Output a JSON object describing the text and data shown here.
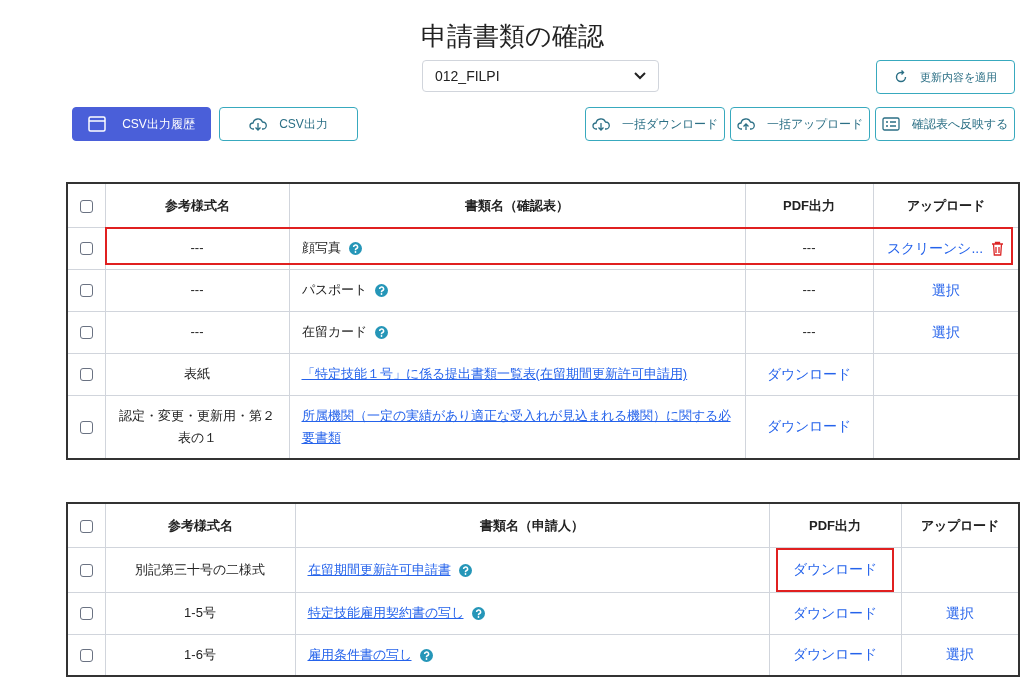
{
  "title": "申請書類の確認",
  "select": {
    "value": "012_FILPI"
  },
  "apply_button": {
    "label": "更新内容を適用"
  },
  "toolbar_left": [
    {
      "label": "CSV出力履歴",
      "kind": "history",
      "primary": true
    },
    {
      "label": "CSV出力",
      "kind": "download",
      "primary": false
    }
  ],
  "toolbar_right": [
    {
      "label": "一括ダウンロード",
      "kind": "download"
    },
    {
      "label": "一括アップロード",
      "kind": "upload"
    },
    {
      "label": "確認表へ反映する",
      "kind": "list"
    }
  ],
  "tables": [
    {
      "columns": [
        "参考様式名",
        "書類名（確認表）",
        "PDF出力",
        "アップロード"
      ],
      "all_checked": false,
      "rows": [
        {
          "checked": false,
          "highlighted": true,
          "form": "---",
          "doc": {
            "text": "顔写真",
            "link": false,
            "help": true
          },
          "pdf": {
            "text": "---",
            "link": false
          },
          "upload": {
            "text": "スクリーンシ...",
            "trash": true
          }
        },
        {
          "checked": false,
          "highlighted": false,
          "form": "---",
          "doc": {
            "text": "パスポート",
            "link": false,
            "help": true
          },
          "pdf": {
            "text": "---",
            "link": false
          },
          "upload": {
            "text": "選択",
            "trash": false
          }
        },
        {
          "checked": false,
          "highlighted": false,
          "form": "---",
          "doc": {
            "text": "在留カード",
            "link": false,
            "help": true
          },
          "pdf": {
            "text": "---",
            "link": false
          },
          "upload": {
            "text": "選択",
            "trash": false
          }
        },
        {
          "checked": false,
          "highlighted": false,
          "form": "表紙",
          "doc": {
            "text": "「特定技能１号」に係る提出書類一覧表(在留期間更新許可申請用)",
            "link": true,
            "help": false
          },
          "pdf": {
            "text": "ダウンロード",
            "link": true
          }
        },
        {
          "checked": false,
          "highlighted": false,
          "form": "認定・変更・更新用・第２表の１",
          "doc": {
            "text": "所属機関（一定の実績があり適正な受入れが見込まれる機関）に関する必要書類",
            "link": true,
            "help": false
          },
          "pdf": {
            "text": "ダウンロード",
            "link": true
          }
        }
      ]
    },
    {
      "columns": [
        "参考様式名",
        "書類名（申請人）",
        "PDF出力",
        "アップロード"
      ],
      "all_checked": false,
      "rows": [
        {
          "checked": false,
          "highlighted": false,
          "form": "別記第三十号の二様式",
          "doc": {
            "text": "在留期間更新許可申請書",
            "link": true,
            "help": true
          },
          "pdf": {
            "text": "ダウンロード",
            "link": true,
            "highlighted": true
          }
        },
        {
          "checked": false,
          "highlighted": false,
          "form": "1-5号",
          "doc": {
            "text": "特定技能雇用契約書の写し",
            "link": true,
            "help": true
          },
          "pdf": {
            "text": "ダウンロード",
            "link": true,
            "highlighted": false
          },
          "upload": {
            "text": "選択",
            "trash": false
          }
        },
        {
          "checked": false,
          "highlighted": false,
          "form": "1-6号",
          "doc": {
            "text": "雇用条件書の写し",
            "link": true,
            "help": true
          },
          "pdf": {
            "text": "ダウンロード",
            "link": true,
            "highlighted": false
          },
          "upload": {
            "text": "選択",
            "trash": false
          }
        }
      ]
    }
  ]
}
